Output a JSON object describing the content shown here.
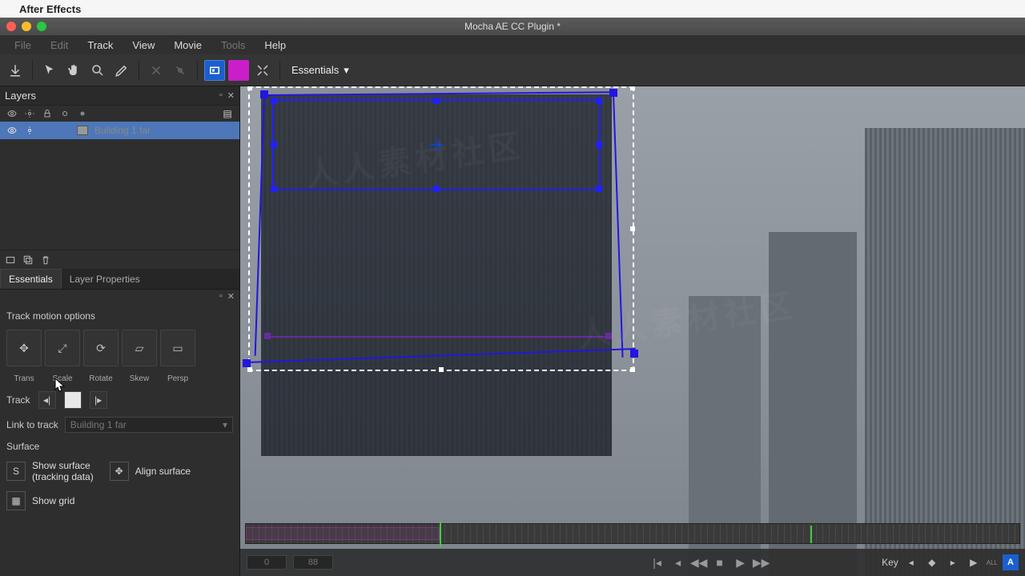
{
  "mac_menubar": {
    "app": "After Effects"
  },
  "window_title": "Mocha AE CC Plugin *",
  "app_menu": {
    "file": "File",
    "edit": "Edit",
    "track": "Track",
    "view": "View",
    "movie": "Movie",
    "tools": "Tools",
    "help": "Help"
  },
  "toolbar": {
    "workspace": "Essentials"
  },
  "layers_panel": {
    "title": "Layers",
    "layer_name": "Building 1 far"
  },
  "tabs": {
    "essentials": "Essentials",
    "layer_props": "Layer Properties"
  },
  "essentials": {
    "track_motion_label": "Track motion options",
    "opts": {
      "trans": "Trans",
      "scale": "Scale",
      "rotate": "Rotate",
      "skew": "Skew",
      "persp": "Persp"
    },
    "track_label": "Track",
    "link_label": "Link to track",
    "link_value": "Building 1 far",
    "surface_label": "Surface",
    "show_surface": "Show surface\n(tracking data)",
    "align_surface": "Align surface",
    "show_grid": "Show grid"
  },
  "bottom": {
    "frame_a": "0",
    "frame_b": "88",
    "key_label": "Key",
    "all_label": "ALL",
    "a_label": "A"
  }
}
